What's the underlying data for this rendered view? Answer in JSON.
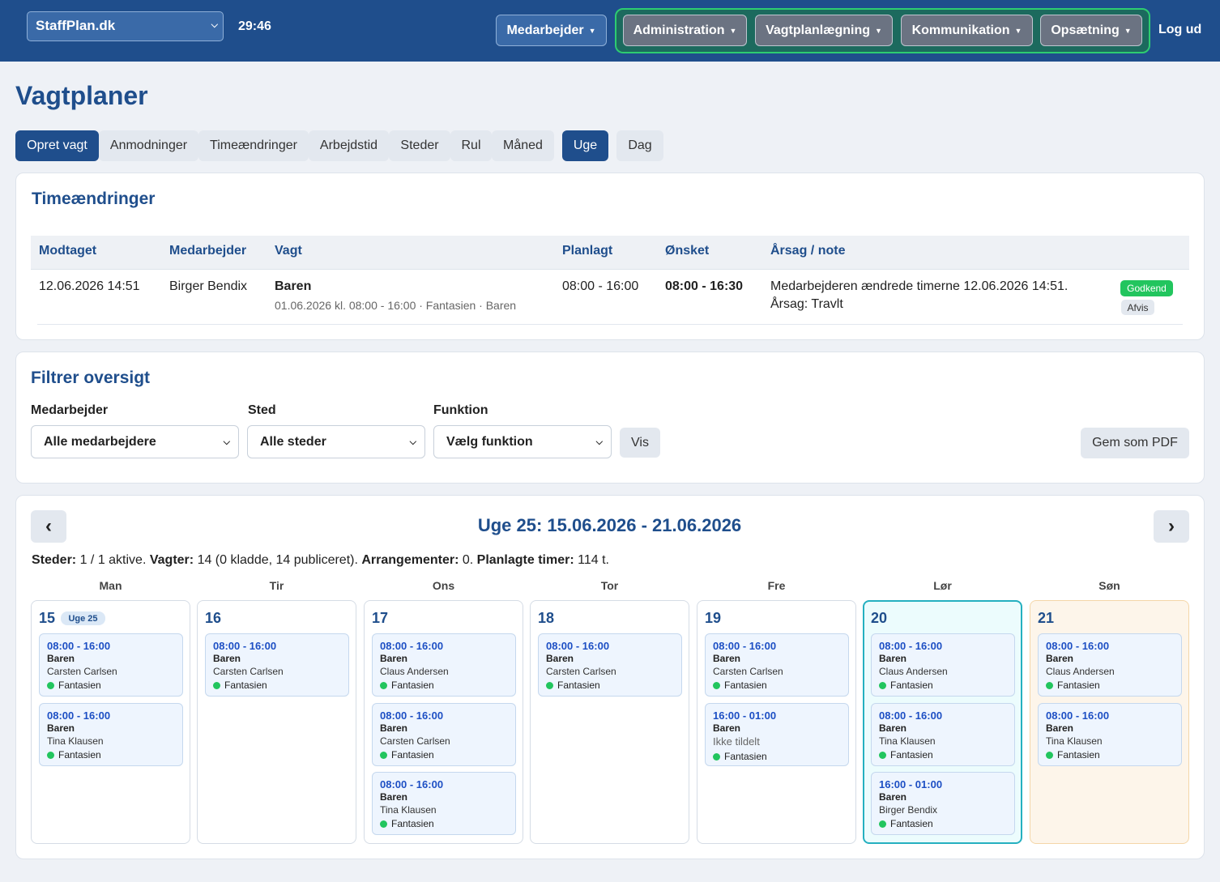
{
  "topbar": {
    "site": "StaffPlan.dk",
    "timer": "29:46",
    "employee_menu": "Medarbejder",
    "menus": [
      "Administration",
      "Vagtplanlægning",
      "Kommunikation",
      "Opsætning"
    ],
    "logout": "Log ud"
  },
  "page_title": "Vagtplaner",
  "tabs": [
    "Opret vagt",
    "Anmodninger",
    "Timeændringer",
    "Arbejdstid",
    "Steder",
    "Rul",
    "Måned",
    "Uge",
    "Dag"
  ],
  "changes": {
    "title": "Timeændringer",
    "headers": [
      "Modtaget",
      "Medarbejder",
      "Vagt",
      "Planlagt",
      "Ønsket",
      "Årsag / note"
    ],
    "row": {
      "received": "12.06.2026 14:51",
      "employee": "Birger Bendix",
      "shift": "Baren",
      "shift_detail": "01.06.2026 kl. 08:00 - 16:00 · Fantasien · Baren",
      "planned": "08:00 - 16:00",
      "wanted": "08:00 - 16:30",
      "note1": "Medarbejderen ændrede timerne 12.06.2026 14:51.",
      "note2": "Årsag: Travlt",
      "approve": "Godkend",
      "reject": "Afvis"
    }
  },
  "filter": {
    "title": "Filtrer oversigt",
    "employee_label": "Medarbejder",
    "employee_value": "Alle medarbejdere",
    "place_label": "Sted",
    "place_value": "Alle steder",
    "function_label": "Funktion",
    "function_value": "Vælg funktion",
    "show": "Vis",
    "pdf": "Gem som PDF"
  },
  "week": {
    "prev": "‹",
    "next": "›",
    "title": "Uge 25: 15.06.2026 - 21.06.2026",
    "summary": {
      "places_label": "Steder:",
      "places": "1 / 1 aktive.",
      "shifts_label": "Vagter:",
      "shifts": "14 (0 kladde, 14 publiceret).",
      "events_label": "Arrangementer:",
      "events": "0.",
      "hours_label": "Planlagte timer:",
      "hours": "114 t."
    },
    "week_badge": "Uge 25",
    "days": [
      {
        "name": "Man",
        "num": "15",
        "shifts": [
          {
            "time": "08:00 - 16:00",
            "place": "Baren",
            "person": "Carsten Carlsen",
            "loc": "Fantasien"
          },
          {
            "time": "08:00 - 16:00",
            "place": "Baren",
            "person": "Tina Klausen",
            "loc": "Fantasien"
          }
        ]
      },
      {
        "name": "Tir",
        "num": "16",
        "shifts": [
          {
            "time": "08:00 - 16:00",
            "place": "Baren",
            "person": "Carsten Carlsen",
            "loc": "Fantasien"
          }
        ]
      },
      {
        "name": "Ons",
        "num": "17",
        "shifts": [
          {
            "time": "08:00 - 16:00",
            "place": "Baren",
            "person": "Claus Andersen",
            "loc": "Fantasien"
          },
          {
            "time": "08:00 - 16:00",
            "place": "Baren",
            "person": "Carsten Carlsen",
            "loc": "Fantasien"
          },
          {
            "time": "08:00 - 16:00",
            "place": "Baren",
            "person": "Tina Klausen",
            "loc": "Fantasien"
          }
        ]
      },
      {
        "name": "Tor",
        "num": "18",
        "shifts": [
          {
            "time": "08:00 - 16:00",
            "place": "Baren",
            "person": "Carsten Carlsen",
            "loc": "Fantasien"
          }
        ]
      },
      {
        "name": "Fre",
        "num": "19",
        "shifts": [
          {
            "time": "08:00 - 16:00",
            "place": "Baren",
            "person": "Carsten Carlsen",
            "loc": "Fantasien"
          },
          {
            "time": "16:00 - 01:00",
            "place": "Baren",
            "person": "Ikke tildelt",
            "loc": "Fantasien"
          }
        ]
      },
      {
        "name": "Lør",
        "num": "20",
        "shifts": [
          {
            "time": "08:00 - 16:00",
            "place": "Baren",
            "person": "Claus Andersen",
            "loc": "Fantasien"
          },
          {
            "time": "08:00 - 16:00",
            "place": "Baren",
            "person": "Tina Klausen",
            "loc": "Fantasien"
          },
          {
            "time": "16:00 - 01:00",
            "place": "Baren",
            "person": "Birger Bendix",
            "loc": "Fantasien"
          }
        ]
      },
      {
        "name": "Søn",
        "num": "21",
        "shifts": [
          {
            "time": "08:00 - 16:00",
            "place": "Baren",
            "person": "Claus Andersen",
            "loc": "Fantasien"
          },
          {
            "time": "08:00 - 16:00",
            "place": "Baren",
            "person": "Tina Klausen",
            "loc": "Fantasien"
          }
        ]
      }
    ]
  },
  "colors": {
    "primary": "#1f4e8c",
    "accent_green": "#22c55e",
    "shift_time": "#1d4fc4"
  }
}
